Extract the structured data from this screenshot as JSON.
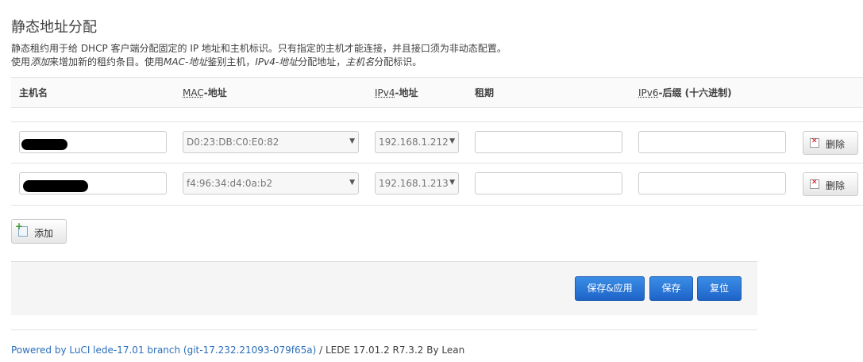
{
  "page": {
    "title": "静态地址分配",
    "desc_line1": "静态租约用于给 DHCP 客户端分配固定的 IP 地址和主机标识。只有指定的主机才能连接，并且接口须为非动态配置。",
    "desc_line2": {
      "p1": "使用",
      "add_word": "添加",
      "p2": "来增加新的租约条目。使用",
      "mac_word": "MAC-地址",
      "p3": "鉴别主机，",
      "ipv4_word": "IPv4-地址",
      "p4": "分配地址，",
      "host_word": "主机名",
      "p5": "分配标识。"
    }
  },
  "table": {
    "headers": {
      "hostname": "主机名",
      "mac_abbr": "MAC",
      "mac_rest": "-地址",
      "ipv4_abbr": "IPv4",
      "ipv4_rest": "-地址",
      "lease": "租期",
      "ipv6_abbr": "IPv6",
      "ipv6_rest": "-后缀 (十六进制)"
    },
    "rows": [
      {
        "hostname": "",
        "mac": "D0:23:DB:C0:E0:82",
        "ipv4": "192.168.1.212",
        "lease": "",
        "ipv6": "",
        "delete_label": "删除"
      },
      {
        "hostname": "",
        "mac": "f4:96:34:d4:0a:b2",
        "ipv4": "192.168.1.213",
        "lease": "",
        "ipv6": "",
        "delete_label": "删除"
      }
    ]
  },
  "buttons": {
    "add": "添加",
    "save_apply": "保存&应用",
    "save": "保存",
    "reset": "复位"
  },
  "footer": {
    "link_text": "Powered by LuCI lede-17.01 branch (git-17.232.21093-079f65a)",
    "rest": " / LEDE 17.01.2 R7.3.2 By Lean"
  }
}
